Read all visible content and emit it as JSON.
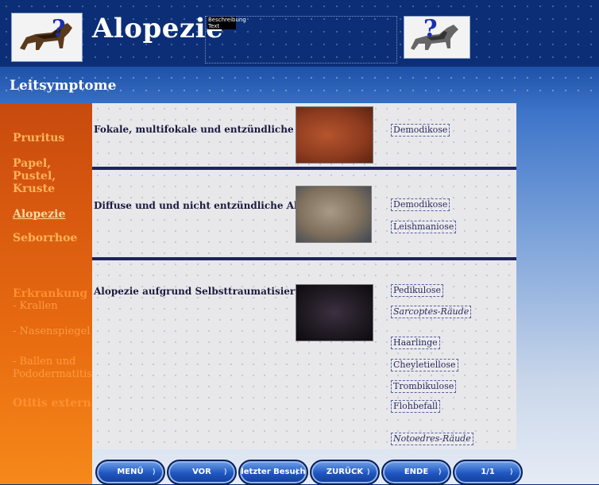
{
  "header": {
    "title": "Alopezie",
    "box_label": "Beschreibung Text"
  },
  "subtitle": "Leitsymptome",
  "sidebar": {
    "items": [
      {
        "label": "Pruritus"
      },
      {
        "label": "Papel, Pustel, Kruste"
      },
      {
        "label": "Alopezie"
      },
      {
        "label": "Seborrhoe"
      },
      {
        "label": "Erkrankung"
      },
      {
        "label": "- Krallen"
      },
      {
        "label": "- Nasenspiegel"
      },
      {
        "label": "- Ballen und Pododermatitis"
      },
      {
        "label": "Otitis externa"
      }
    ]
  },
  "sections": [
    {
      "title": "Fokale, multifokale und entzündliche Alopzie",
      "labels": [
        "Demodikose"
      ]
    },
    {
      "title": "Diffuse und und nicht entzündliche Alopzie",
      "labels": [
        "Demodikose",
        "Leishmaniose"
      ]
    },
    {
      "title": "Alopezie aufgrund Selbsttraumatisierung",
      "labels": [
        "Pedikulose",
        "Sarcoptes-Räude",
        "Haarlinge",
        "Cheyletiellose",
        "Trombikulose",
        "Flohbefall",
        "Notoedres-Räude"
      ]
    }
  ],
  "nav": {
    "buttons": [
      "MENÜ",
      "VOR",
      "letzter Besuch",
      "ZURÜCK",
      "ENDE",
      "1/1"
    ]
  },
  "colors": {
    "header_bg": "#0b2e76",
    "sidebar_bg": "#d6570f",
    "sidebar_text": "#ffb35a",
    "rule": "#1c2360",
    "button": "#1f56c0"
  }
}
